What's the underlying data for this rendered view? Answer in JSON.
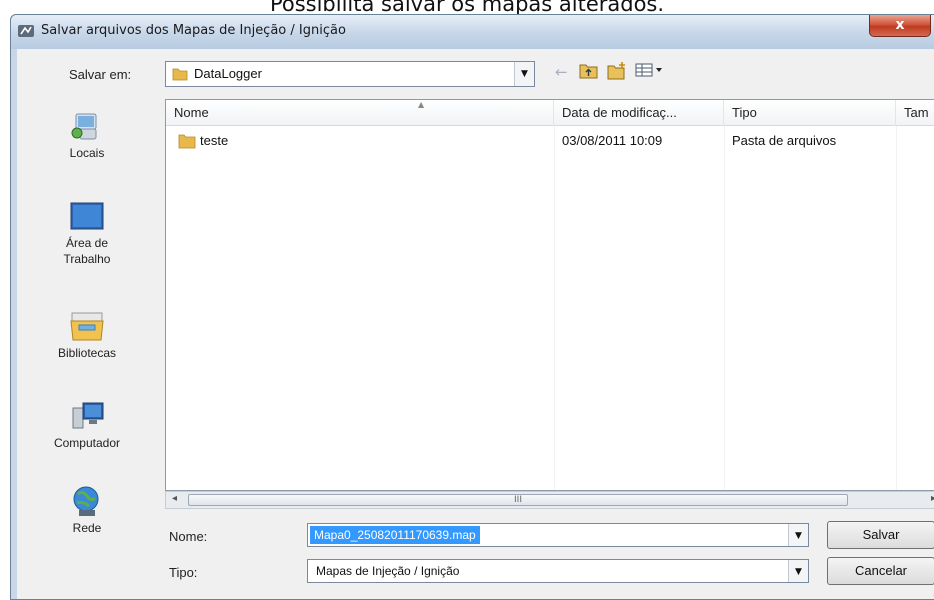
{
  "caption": "Possibilita salvar os mapas alterados.",
  "window": {
    "title": "Salvar arquivos dos Mapas de Injeção / Ignição",
    "close_glyph": "x"
  },
  "save_in": {
    "label": "Salvar em:",
    "value": "DataLogger"
  },
  "toolbar": {
    "back_icon": "back-arrow-icon",
    "up_icon": "up-folder-icon",
    "new_folder_icon": "new-folder-icon",
    "view_icon": "view-menu-icon"
  },
  "places": [
    {
      "label": "Locais",
      "icon": "recent-places-icon"
    },
    {
      "label": "Área de Trabalho",
      "icon": "desktop-icon"
    },
    {
      "label": "Bibliotecas",
      "icon": "libraries-icon"
    },
    {
      "label": "Computador",
      "icon": "computer-icon"
    },
    {
      "label": "Rede",
      "icon": "network-icon"
    }
  ],
  "columns": [
    "Nome",
    "Data de modificaç...",
    "Tipo",
    "Tam"
  ],
  "files": [
    {
      "name": "teste",
      "modified": "03/08/2011 10:09",
      "type": "Pasta de arquivos",
      "icon": "folder-icon"
    }
  ],
  "scroll_mid": "III",
  "filename": {
    "label": "Nome:",
    "value": "Mapa0_25082011170639.map"
  },
  "filetype": {
    "label": "Tipo:",
    "value": "Mapas de Injeção / Ignição"
  },
  "buttons": {
    "save": "Salvar",
    "cancel": "Cancelar"
  },
  "colors": {
    "title_bar": "#c9d8ea",
    "close_button": "#c0391f",
    "selection": "#3399ff",
    "folder": "#e8b84a"
  }
}
